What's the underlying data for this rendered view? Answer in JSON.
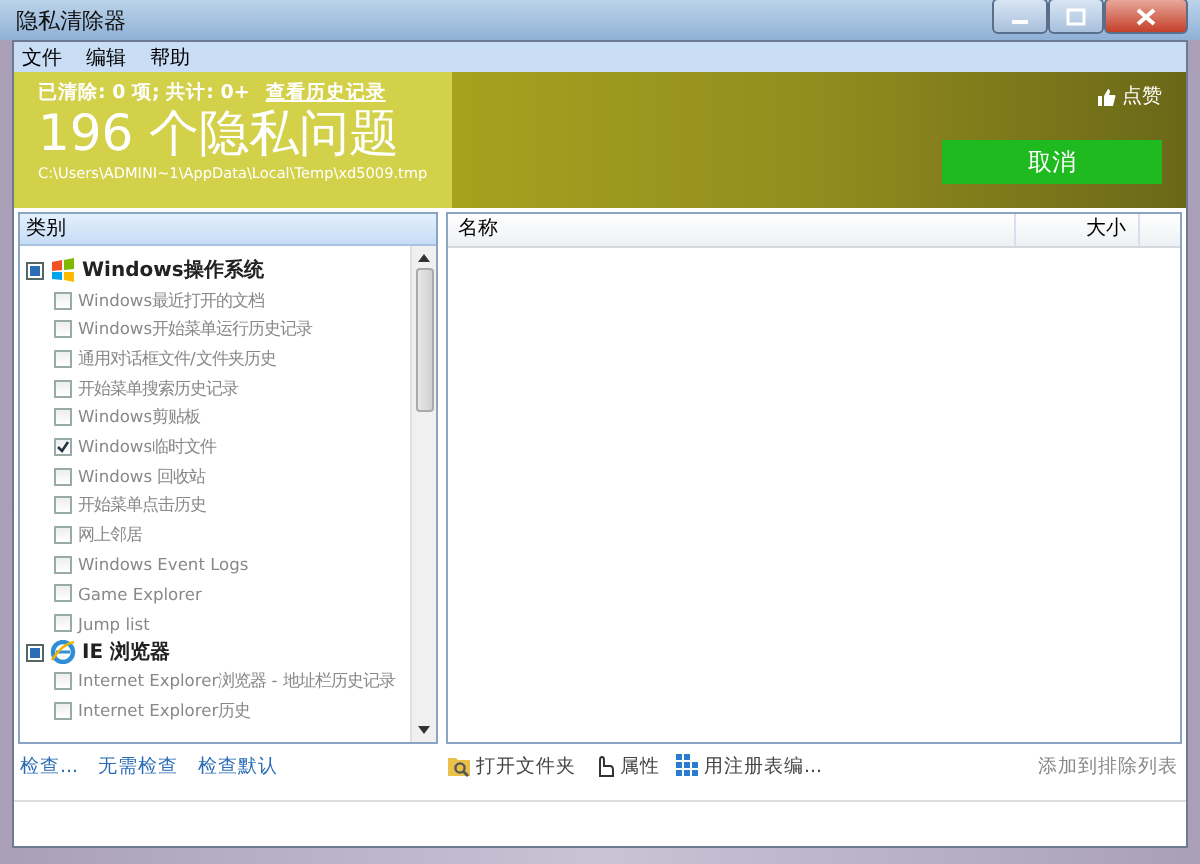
{
  "window": {
    "title": "隐私清除器"
  },
  "menu": [
    "文件",
    "编辑",
    "帮助"
  ],
  "banner": {
    "status": "已清除: 0 项; 共计: 0+",
    "history_link": "查看历史记录",
    "headline": "196 个隐私问题",
    "path": "C:\\Users\\ADMINI~1\\AppData\\Local\\Temp\\xd5009.tmp",
    "like": "点赞",
    "cancel": "取消"
  },
  "tree": {
    "header": "类别",
    "groups": [
      {
        "kind": "windows",
        "label": "Windows操作系统",
        "partial": true,
        "items": [
          {
            "label": "Windows最近打开的文档",
            "checked": false
          },
          {
            "label": "Windows开始菜单运行历史记录",
            "checked": false
          },
          {
            "label": "通用对话框文件/文件夹历史",
            "checked": false
          },
          {
            "label": "开始菜单搜索历史记录",
            "checked": false
          },
          {
            "label": "Windows剪贴板",
            "checked": false
          },
          {
            "label": "Windows临时文件",
            "checked": true
          },
          {
            "label": "Windows 回收站",
            "checked": false
          },
          {
            "label": "开始菜单点击历史",
            "checked": false
          },
          {
            "label": "网上邻居",
            "checked": false
          },
          {
            "label": "Windows Event Logs",
            "checked": false
          },
          {
            "label": "Game Explorer",
            "checked": false
          },
          {
            "label": "Jump list",
            "checked": false
          }
        ]
      },
      {
        "kind": "ie",
        "label": "IE 浏览器",
        "partial": true,
        "items": [
          {
            "label": "Internet Explorer浏览器 - 地址栏历史记录",
            "checked": false
          },
          {
            "label": "Internet Explorer历史",
            "checked": false
          }
        ]
      }
    ]
  },
  "file_list": {
    "columns": [
      "名称",
      "大小"
    ]
  },
  "left_links": [
    "检查...",
    "无需检查",
    "检查默认"
  ],
  "toolbar": [
    {
      "kind": "folder",
      "label": "打开文件夹"
    },
    {
      "kind": "hand",
      "label": "属性"
    },
    {
      "kind": "registry",
      "label": "用注册表编..."
    }
  ],
  "exclude_link": "添加到排除列表"
}
